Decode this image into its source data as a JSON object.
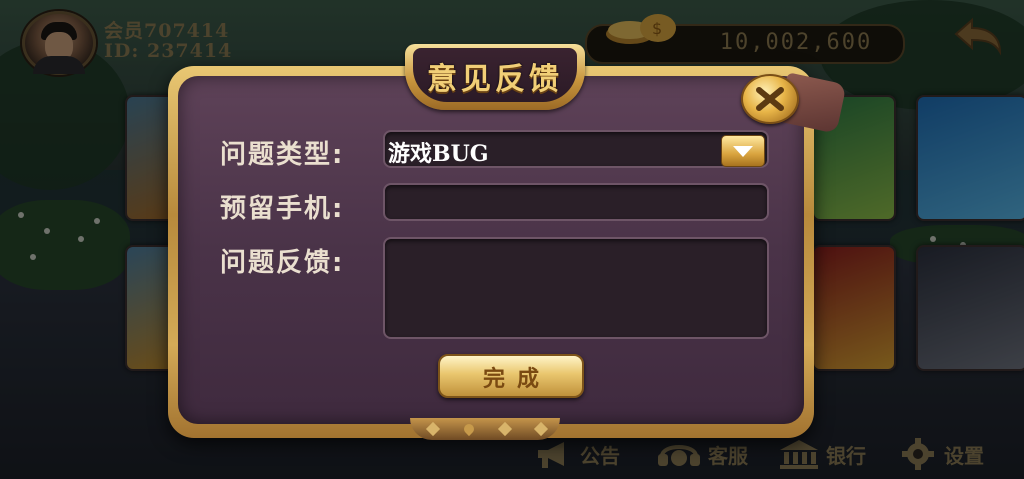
{
  "player": {
    "name": "会员707414",
    "id": "ID: 237414"
  },
  "coins": {
    "value": "10,002,600"
  },
  "dialog": {
    "title": "意见反馈",
    "fields": {
      "type_label": "问题类型:",
      "type_value": "游戏BUG",
      "phone_label": "预留手机:",
      "phone_value": "",
      "feedback_label": "问题反馈:",
      "feedback_value": ""
    },
    "submit_label": "完成"
  },
  "bottom_bar": {
    "notice": "公告",
    "service": "客服",
    "bank": "银行",
    "settings": "设置"
  },
  "colors": {
    "gold": "#e6bd5c",
    "dialog_bg": "#4a3348",
    "label_text": "#eadfcf",
    "muted_gold_text": "#8a7b55"
  },
  "icons": [
    "avatar",
    "gold-coins-icon",
    "back-arrow-icon",
    "close-icon",
    "dropdown-arrow-icon",
    "megaphone-icon",
    "headset-icon",
    "bank-icon",
    "gear-icon"
  ]
}
